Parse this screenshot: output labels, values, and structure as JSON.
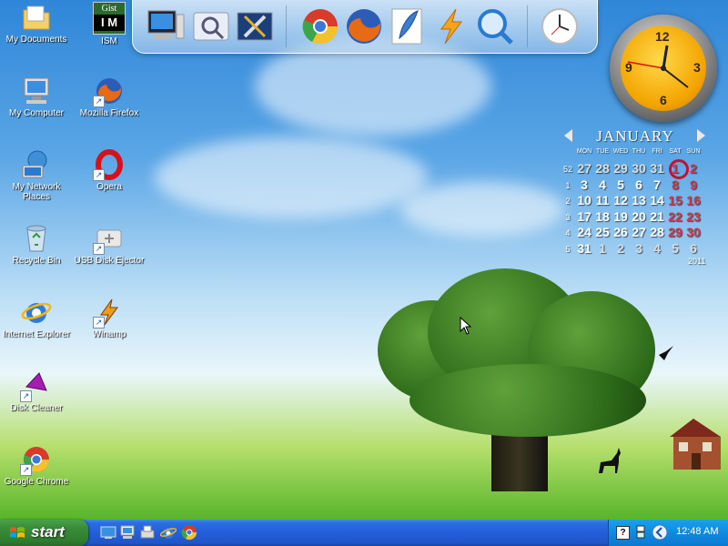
{
  "desktop_icons": [
    {
      "label": "My Documents",
      "icon": "folder-icon"
    },
    {
      "label": "ISM",
      "icon": "gist-ism-icon",
      "badge_top": "Gist",
      "badge_bottom": "I M"
    },
    {
      "label": "My Computer",
      "icon": "computer-icon"
    },
    {
      "label": "Mozilla Firefox",
      "icon": "firefox-icon"
    },
    {
      "label": "My Network Places",
      "icon": "network-icon"
    },
    {
      "label": "Opera",
      "icon": "opera-icon"
    },
    {
      "label": "Recycle Bin",
      "icon": "recycle-bin-icon"
    },
    {
      "label": "USB Disk Ejector",
      "icon": "usb-icon"
    },
    {
      "label": "Internet Explorer",
      "icon": "ie-icon"
    },
    {
      "label": "Winamp",
      "icon": "winamp-icon"
    },
    {
      "label": "Disk Cleaner",
      "icon": "disk-cleaner-icon"
    },
    {
      "label": "Google Chrome",
      "icon": "chrome-icon"
    }
  ],
  "dock": {
    "items": [
      "computer-icon",
      "search-folder-icon",
      "tools-icon",
      "chrome-icon",
      "firefox-icon",
      "feather-icon",
      "lightning-icon",
      "search-icon",
      "clock-icon"
    ]
  },
  "clock_widget": {
    "numbers": [
      "12",
      "3",
      "6",
      "9"
    ]
  },
  "calendar": {
    "month": "JANUARY",
    "year": "2011",
    "days": [
      "MON",
      "TUE",
      "WED",
      "THU",
      "FRI",
      "SAT",
      "SUN"
    ],
    "weeks": [
      {
        "wk": "52",
        "d": [
          "27",
          "28",
          "29",
          "30",
          "31",
          "1",
          "2"
        ]
      },
      {
        "wk": "1",
        "d": [
          "3",
          "4",
          "5",
          "6",
          "7",
          "8",
          "9"
        ]
      },
      {
        "wk": "2",
        "d": [
          "10",
          "11",
          "12",
          "13",
          "14",
          "15",
          "16"
        ]
      },
      {
        "wk": "3",
        "d": [
          "17",
          "18",
          "19",
          "20",
          "21",
          "22",
          "23"
        ]
      },
      {
        "wk": "4",
        "d": [
          "24",
          "25",
          "26",
          "27",
          "28",
          "29",
          "30"
        ]
      },
      {
        "wk": "5",
        "d": [
          "31",
          "1",
          "2",
          "3",
          "4",
          "5",
          "6"
        ]
      }
    ],
    "today": "1"
  },
  "taskbar": {
    "start_label": "start",
    "quick_launch": [
      "desktop-icon",
      "computer-icon",
      "printer-icon",
      "ie-icon",
      "chrome-icon"
    ],
    "tray_help": "?",
    "time": "12:48 AM"
  },
  "colors": {
    "accent": "#245edb",
    "start_green": "#3a8d3a",
    "weekend_red": "#d9354a"
  }
}
